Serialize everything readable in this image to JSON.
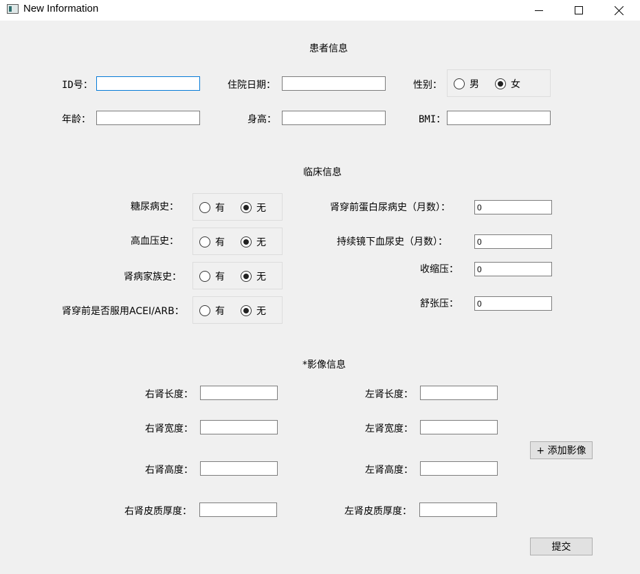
{
  "window": {
    "title": "New Information"
  },
  "patient": {
    "section_title": "患者信息",
    "id_label": "ID号：",
    "id_value": "",
    "admission_label": "住院日期：",
    "admission_value": "",
    "gender_label": "性别：",
    "gender_options": [
      "男",
      "女"
    ],
    "gender_selected": "女",
    "age_label": "年龄：",
    "age_value": "",
    "height_label": "身高：",
    "height_value": "",
    "bmi_label": "BMI：",
    "bmi_value": ""
  },
  "clinical": {
    "section_title": "临床信息",
    "yes_label": "有",
    "no_label": "无",
    "diabetes_label": "糖尿病史：",
    "diabetes_selected": "无",
    "hypertension_label": "高血压史：",
    "hypertension_selected": "无",
    "family_label": "肾病家族史：",
    "family_selected": "无",
    "acei_label": "肾穿前是否服用ACEI/ARB：",
    "acei_selected": "无",
    "proteinuria_label": "肾穿前蛋白尿病史（月数）：",
    "proteinuria_value": "0",
    "hematuria_label": "持续镜下血尿史（月数）：",
    "hematuria_value": "0",
    "systolic_label": "收缩压：",
    "systolic_value": "0",
    "diastolic_label": "舒张压：",
    "diastolic_value": "0"
  },
  "imaging": {
    "section_title": "*影像信息",
    "right_length_label": "右肾长度：",
    "right_length_value": "",
    "left_length_label": "左肾长度：",
    "left_length_value": "",
    "right_width_label": "右肾宽度：",
    "right_width_value": "",
    "left_width_label": "左肾宽度：",
    "left_width_value": "",
    "right_height_label": "右肾高度：",
    "right_height_value": "",
    "left_height_label": "左肾高度：",
    "left_height_value": "",
    "right_cortex_label": "右肾皮质厚度：",
    "right_cortex_value": "",
    "left_cortex_label": "左肾皮质厚度：",
    "left_cortex_value": "",
    "add_image_label": "+ 添加影像"
  },
  "submit_label": "提交"
}
